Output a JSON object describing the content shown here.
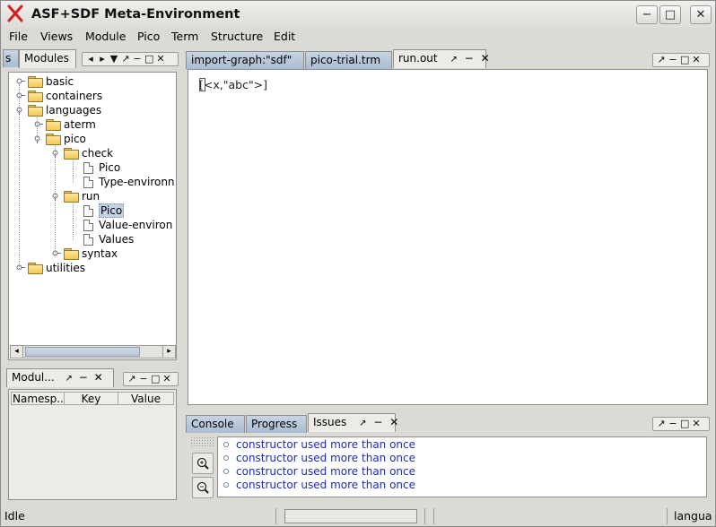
{
  "window": {
    "title": "ASF+SDF Meta-Environment",
    "controls": {
      "minimize": "−",
      "maximize": "□",
      "close": "✕"
    }
  },
  "menu": [
    "File",
    "Views",
    "Module",
    "Pico",
    "Term",
    "Structure",
    "Edit"
  ],
  "modules_panel": {
    "tabs": [
      "s",
      "Modules"
    ],
    "tab_controls": [
      "◂",
      "▸",
      "▼",
      "↗",
      "−",
      "□",
      "✕"
    ],
    "tree": [
      {
        "label": "basic",
        "type": "folder"
      },
      {
        "label": "containers",
        "type": "folder"
      },
      {
        "label": "languages",
        "type": "folder"
      },
      {
        "label": "aterm",
        "type": "folder"
      },
      {
        "label": "pico",
        "type": "folder"
      },
      {
        "label": "check",
        "type": "folder"
      },
      {
        "label": "Pico",
        "type": "file"
      },
      {
        "label": "Type-environn",
        "type": "file"
      },
      {
        "label": "run",
        "type": "folder"
      },
      {
        "label": "Pico",
        "type": "file",
        "selected": true
      },
      {
        "label": "Value-environ",
        "type": "file"
      },
      {
        "label": "Values",
        "type": "file"
      },
      {
        "label": "syntax",
        "type": "folder"
      },
      {
        "label": "utilities",
        "type": "folder"
      }
    ]
  },
  "module_info_panel": {
    "tab": "Modul...",
    "tab_controls": [
      "↗",
      "−",
      "✕"
    ],
    "window_controls": [
      "↗",
      "−",
      "□",
      "✕"
    ],
    "columns": [
      "Namesp...",
      "Key",
      "Value"
    ]
  },
  "editor_panel": {
    "tabs": [
      "import-graph:\"sdf\"",
      "pico-trial.trm",
      "run.out"
    ],
    "active_tab_controls": [
      "↗",
      "−",
      "✕"
    ],
    "window_controls": [
      "↗",
      "−",
      "□",
      "✕"
    ],
    "content": "[<x,\"abc\">]"
  },
  "bottom_panel": {
    "tabs": [
      "Console",
      "Progress",
      "Issues"
    ],
    "active_tab_controls": [
      "↗",
      "−",
      "✕"
    ],
    "window_controls": [
      "↗",
      "−",
      "□",
      "✕"
    ],
    "issues": [
      "constructor used more than once",
      "constructor used more than once",
      "constructor used more than once",
      "constructor used more than once"
    ]
  },
  "status": {
    "left": "Idle",
    "right": "langua"
  },
  "colors": {
    "tab_inactive": "#b3c3d6",
    "selection": "#c3d3e5",
    "issue_text": "#1b2bb8",
    "logo": "#d42020"
  }
}
